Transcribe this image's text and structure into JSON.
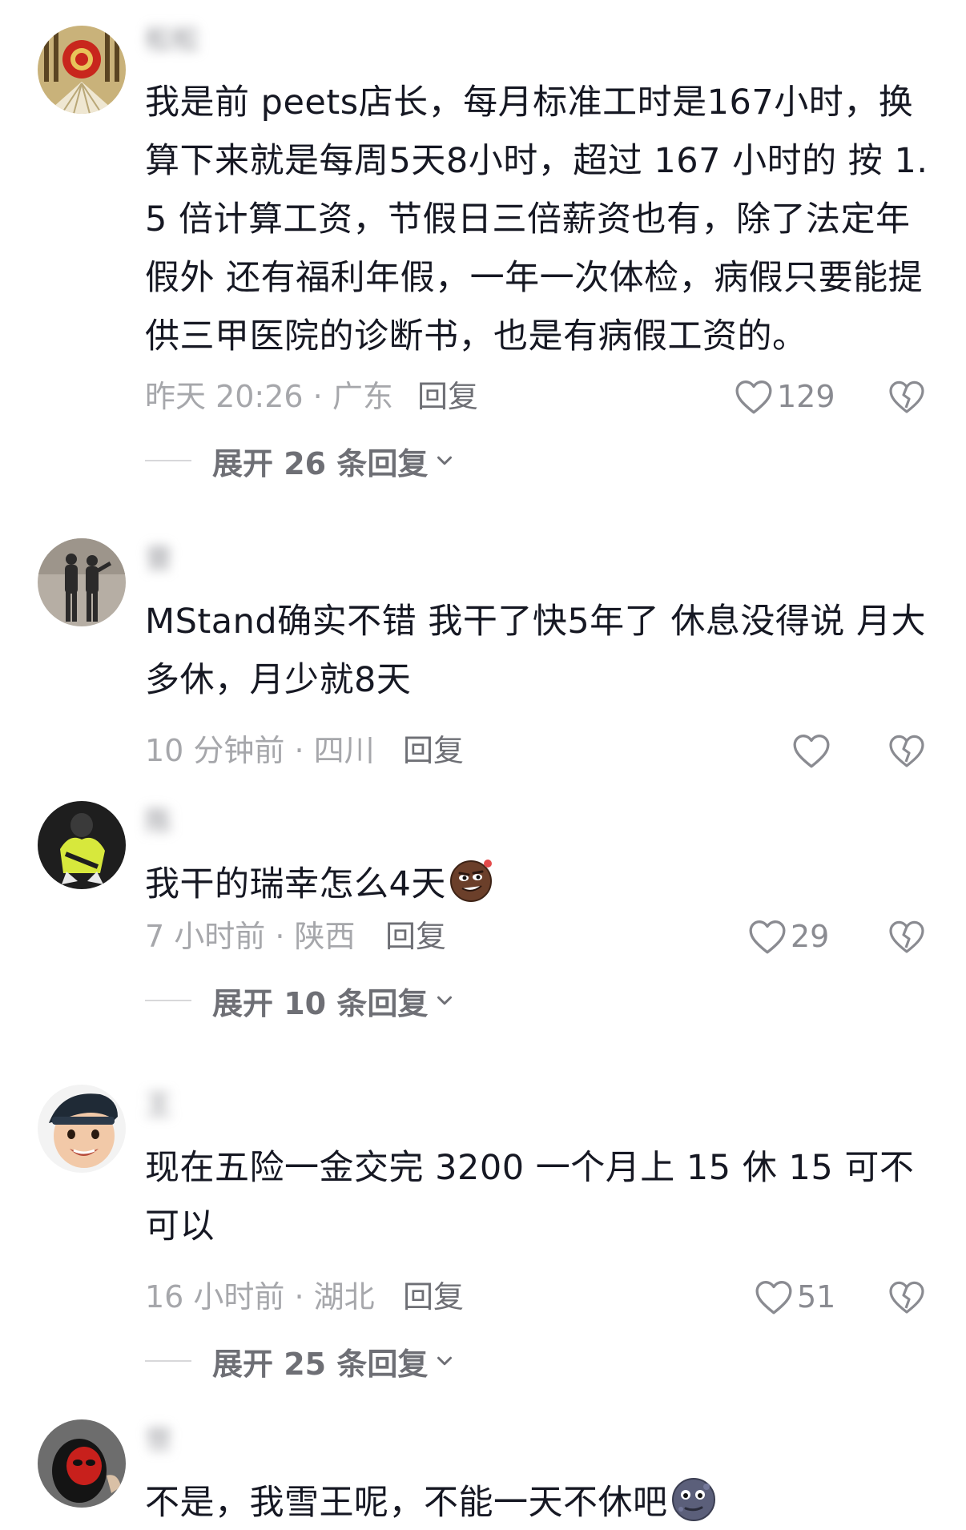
{
  "comments": [
    {
      "username": "松松",
      "avatar": "red-emblem-avatar",
      "text": "我是前 peets店长，每月标准工时是167小时，换算下来就是每周5天8小时，超过 167 小时的 按 1.5 倍计算工资，节假日三倍薪资也有，除了法定年假外 还有福利年假，一年一次体检，病假只要能提供三甲医院的诊断书，也是有病假工资的。",
      "meta": "昨天 20:26 · 广东",
      "reply_label": "回复",
      "likes": "129",
      "expand_label": "展开 26 条回复"
    },
    {
      "username": "曾",
      "avatar": "shadow-photo-avatar",
      "text": "MStand确实不错 我干了快5年了  休息没得说 月大多休，月少就8天",
      "meta": "10 分钟前 · 四川",
      "reply_label": "回复",
      "likes": ""
    },
    {
      "username": "陈",
      "avatar": "yellow-jacket-avatar",
      "text": "我干的瑞幸怎么4天",
      "emoji": "smirk-emoji",
      "meta": "7 小时前 · 陕西",
      "reply_label": "回复",
      "likes": "29",
      "expand_label": "展开 10 条回复"
    },
    {
      "username": "王",
      "avatar": "baby-face-avatar",
      "text": "现在五险一金交完 3200 一个月上 15 休 15 可不可以",
      "meta": "16 小时前 · 湖北",
      "reply_label": "回复",
      "likes": "51",
      "expand_label": "展开 25 条回复"
    },
    {
      "username": "世",
      "avatar": "red-mask-avatar",
      "text": "不是，我雪王呢，不能一天不休吧",
      "emoji": "moon-face-emoji"
    }
  ],
  "colors": {
    "text": "#161823",
    "meta": "#a6a7ab",
    "action": "#6e6f75"
  }
}
